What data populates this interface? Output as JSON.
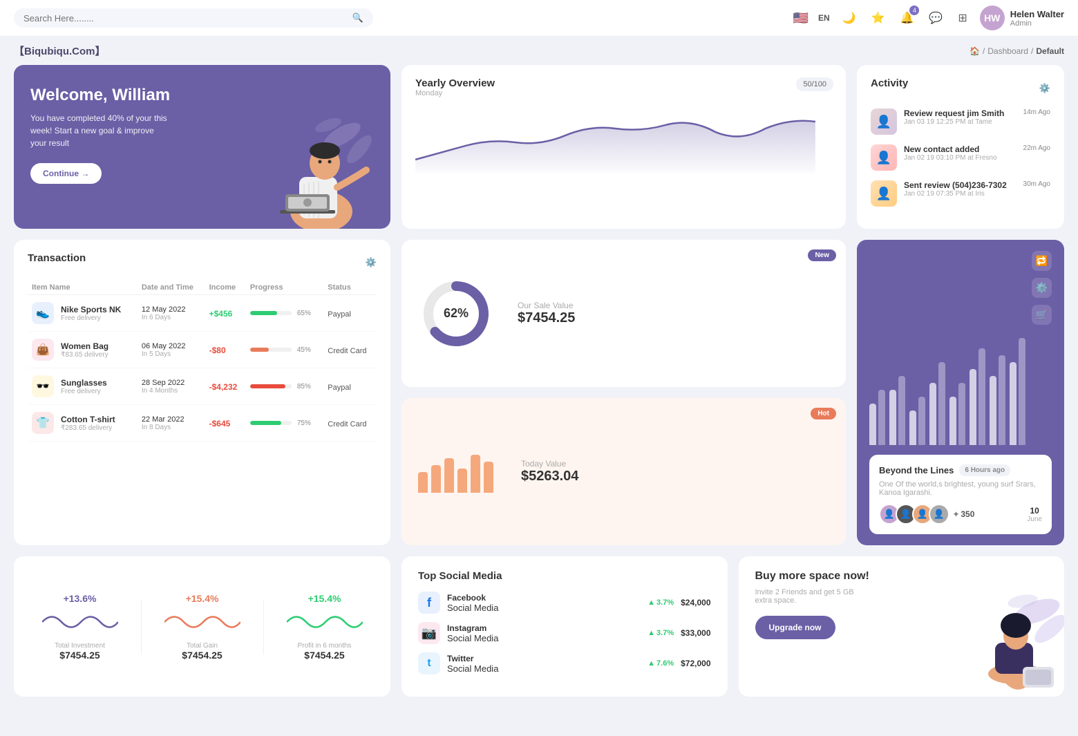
{
  "topnav": {
    "search_placeholder": "Search Here........",
    "lang": "EN",
    "username": "Helen Walter",
    "user_role": "Admin",
    "notification_count": "4"
  },
  "breadcrumb": {
    "brand": "【Biqubiqu.Com】",
    "home": "Home",
    "dashboard": "Dashboard",
    "current": "Default"
  },
  "welcome": {
    "title": "Welcome, William",
    "desc": "You have completed 40% of your this week! Start a new goal & improve your result",
    "button": "Continue →"
  },
  "yearly": {
    "title": "Yearly Overview",
    "subtitle": "Monday",
    "score": "50/100"
  },
  "activity": {
    "title": "Activity",
    "items": [
      {
        "title": "Review request jim Smith",
        "sub": "Jan 03 19 12:25 PM at Tame",
        "time": "14m Ago"
      },
      {
        "title": "New contact added",
        "sub": "Jan 02 19 03:10 PM at Fresno",
        "time": "22m Ago"
      },
      {
        "title": "Sent review (504)236-7302",
        "sub": "Jan 02 19 07:35 PM at Iris",
        "time": "30m Ago"
      }
    ]
  },
  "transaction": {
    "title": "Transaction",
    "headers": [
      "Item Name",
      "Date and Time",
      "Income",
      "Progress",
      "Status"
    ],
    "rows": [
      {
        "icon": "👟",
        "icon_bg": "tx-icon-nike",
        "name": "Nike Sports NK",
        "sub": "Free delivery",
        "date": "12 May 2022",
        "date_sub": "In 6 Days",
        "income": "+$456",
        "income_type": "pos",
        "progress": 65,
        "progress_color": "#2ecc71",
        "status": "Paypal"
      },
      {
        "icon": "👜",
        "icon_bg": "tx-icon-bag",
        "name": "Women Bag",
        "sub": "₹83.65 delivery",
        "date": "06 May 2022",
        "date_sub": "In 5 Days",
        "income": "-$80",
        "income_type": "neg",
        "progress": 45,
        "progress_color": "#e97b5a",
        "status": "Credit Card"
      },
      {
        "icon": "🕶️",
        "icon_bg": "tx-icon-glasses",
        "name": "Sunglasses",
        "sub": "Free delivery",
        "date": "28 Sep 2022",
        "date_sub": "In 4 Months",
        "income": "-$4,232",
        "income_type": "neg",
        "progress": 85,
        "progress_color": "#e74c3c",
        "status": "Paypal"
      },
      {
        "icon": "👕",
        "icon_bg": "tx-icon-shirt",
        "name": "Cotton T-shirt",
        "sub": "₹283.65 delivery",
        "date": "22 Mar 2022",
        "date_sub": "In 8 Days",
        "income": "-$645",
        "income_type": "neg",
        "progress": 75,
        "progress_color": "#2ecc71",
        "status": "Credit Card"
      }
    ]
  },
  "sale_value": {
    "badge": "New",
    "label": "Our Sale Value",
    "amount": "$7454.25",
    "donut_pct": 62,
    "donut_label": "62%"
  },
  "today_value": {
    "badge": "Hot",
    "label": "Today Value",
    "amount": "$5263.04"
  },
  "bar_chart": {
    "title": "Beyond the Lines",
    "time_ago": "6 Hours ago",
    "desc": "One Of the world,s brightest, young surf Srars, Kanoa Igarashi.",
    "plus_count": "+ 350",
    "date": "10",
    "month": "June"
  },
  "investments": {
    "items": [
      {
        "percent": "+13.6%",
        "color": "purple",
        "label": "Total Investment",
        "value": "$7454.25"
      },
      {
        "percent": "+15.4%",
        "color": "orange",
        "label": "Total Gain",
        "value": "$7454.25"
      },
      {
        "percent": "+15.4%",
        "color": "green",
        "label": "Profit in 6 months",
        "value": "$7454.25"
      }
    ]
  },
  "social": {
    "title": "Top Social Media",
    "items": [
      {
        "icon": "f",
        "icon_bg": "fb-bg",
        "icon_color": "#1877f2",
        "name": "Facebook",
        "sub": "Social Media",
        "change": "3.7%",
        "amount": "$24,000"
      },
      {
        "icon": "📷",
        "icon_bg": "ig-bg",
        "icon_color": "#e1306c",
        "name": "Instagram",
        "sub": "Social Media",
        "change": "3.7%",
        "amount": "$33,000"
      },
      {
        "icon": "t",
        "icon_bg": "tw-bg",
        "icon_color": "#1da1f2",
        "name": "Twitter",
        "sub": "Social Media",
        "change": "7.6%",
        "amount": "$72,000"
      }
    ]
  },
  "buy_space": {
    "title": "Buy more space now!",
    "desc": "Invite 2 Friends and get 5 GB extra space.",
    "button": "Upgrade now"
  }
}
